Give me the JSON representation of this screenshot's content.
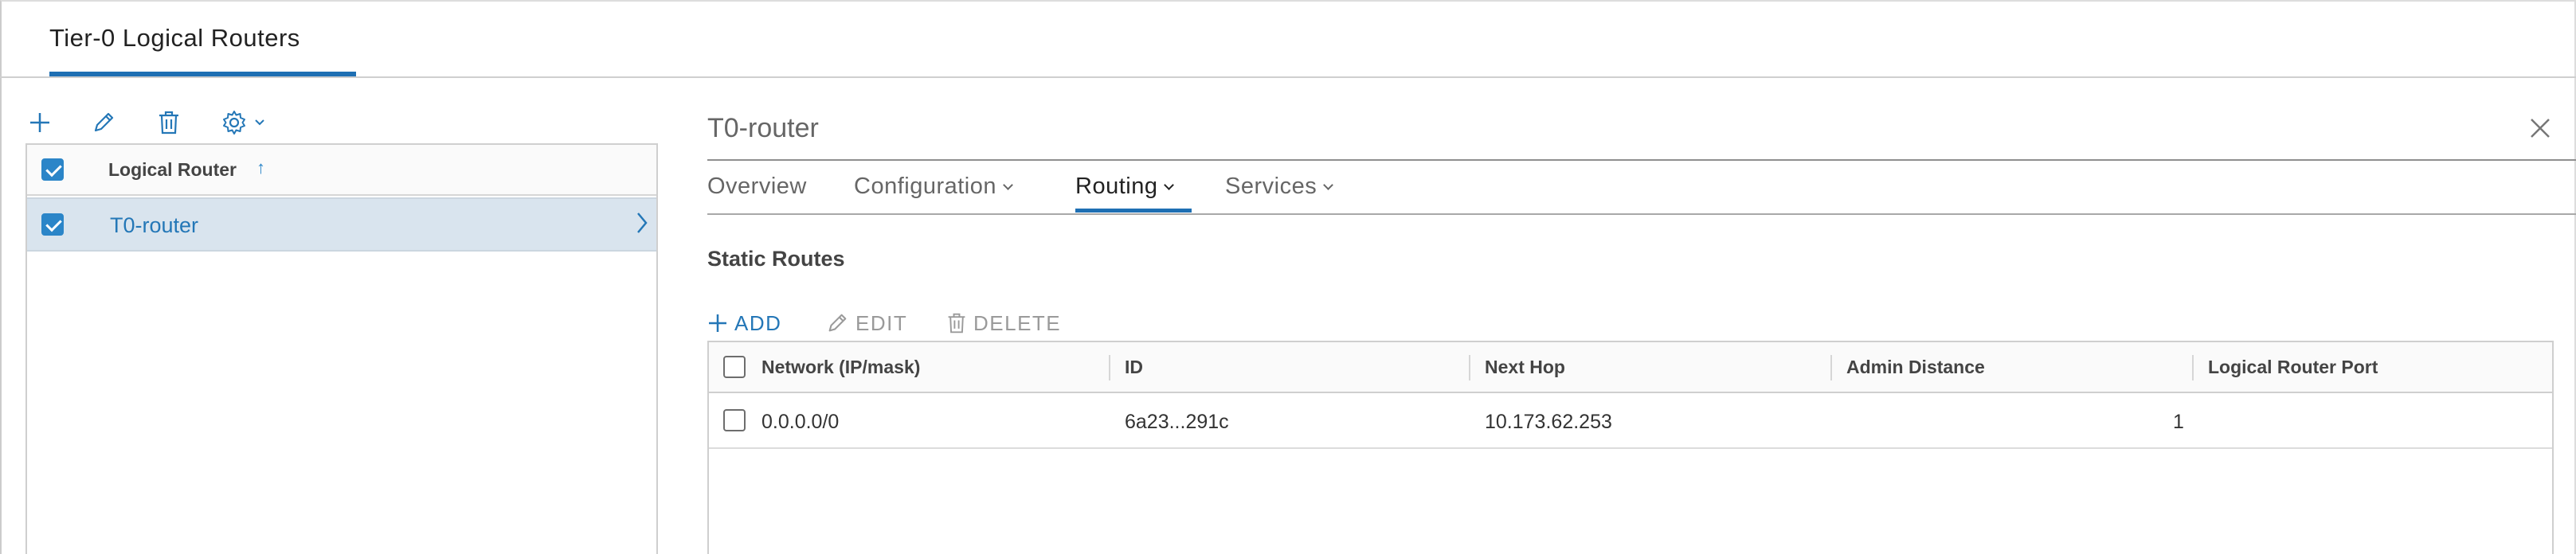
{
  "header": {
    "title": "Tier-0 Logical Routers"
  },
  "left_toolbar": {
    "icons": [
      "add-icon",
      "edit-pencil-icon",
      "delete-trash-icon",
      "settings-gear-icon",
      "chevron-down-icon"
    ]
  },
  "left_list": {
    "column_header": "Logical Router",
    "sort_indicator": "↑",
    "rows": [
      {
        "name": "T0-router",
        "checked": true
      }
    ]
  },
  "detail": {
    "title": "T0-router",
    "tabs": [
      {
        "label": "Overview",
        "dropdown": false
      },
      {
        "label": "Configuration",
        "dropdown": true
      },
      {
        "label": "Routing",
        "dropdown": true,
        "active": true
      },
      {
        "label": "Services",
        "dropdown": true
      }
    ],
    "section_title": "Static Routes",
    "actions": {
      "add": "ADD",
      "edit": "EDIT",
      "delete": "DELETE"
    },
    "table": {
      "columns": [
        "Network (IP/mask)",
        "ID",
        "Next Hop",
        "Admin Distance",
        "Logical Router Port"
      ],
      "rows": [
        {
          "network": "0.0.0.0/0",
          "id": "6a23...291c",
          "next_hop": "10.173.62.253",
          "admin_distance": "1",
          "logical_router_port": ""
        }
      ]
    }
  },
  "colors": {
    "accent": "#1e6fb3",
    "link": "#2477b7",
    "selected_row": "#d9e4ee",
    "checkbox": "#2b85c8"
  }
}
